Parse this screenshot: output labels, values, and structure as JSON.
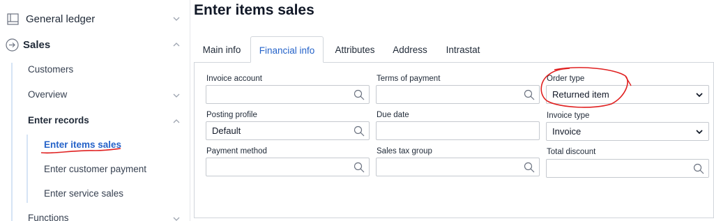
{
  "sidebar": {
    "general_ledger": "General ledger",
    "sales": "Sales",
    "sub_items": [
      "Customers",
      "Overview",
      "Enter records"
    ],
    "enter_records_items": [
      "Enter items sales",
      "Enter customer payment",
      "Enter service sales"
    ],
    "functions": "Functions"
  },
  "page": {
    "title": "Enter items sales"
  },
  "tabs": [
    "Main info",
    "Financial info",
    "Attributes",
    "Address",
    "Intrastat"
  ],
  "active_tab": "Financial info",
  "form": {
    "invoice_account": {
      "label": "Invoice account",
      "value": ""
    },
    "terms_of_payment": {
      "label": "Terms of payment",
      "value": ""
    },
    "order_type": {
      "label": "Order type",
      "value": "Returned item"
    },
    "posting_profile": {
      "label": "Posting profile",
      "value": "Default"
    },
    "due_date": {
      "label": "Due date",
      "value": ""
    },
    "invoice_type": {
      "label": "Invoice type",
      "value": "Invoice"
    },
    "payment_method": {
      "label": "Payment method",
      "value": ""
    },
    "sales_tax_group": {
      "label": "Sales tax group",
      "value": ""
    },
    "total_discount": {
      "label": "Total discount",
      "value": ""
    }
  },
  "colors": {
    "accent": "#2563c9",
    "annotation": "#e02020"
  }
}
